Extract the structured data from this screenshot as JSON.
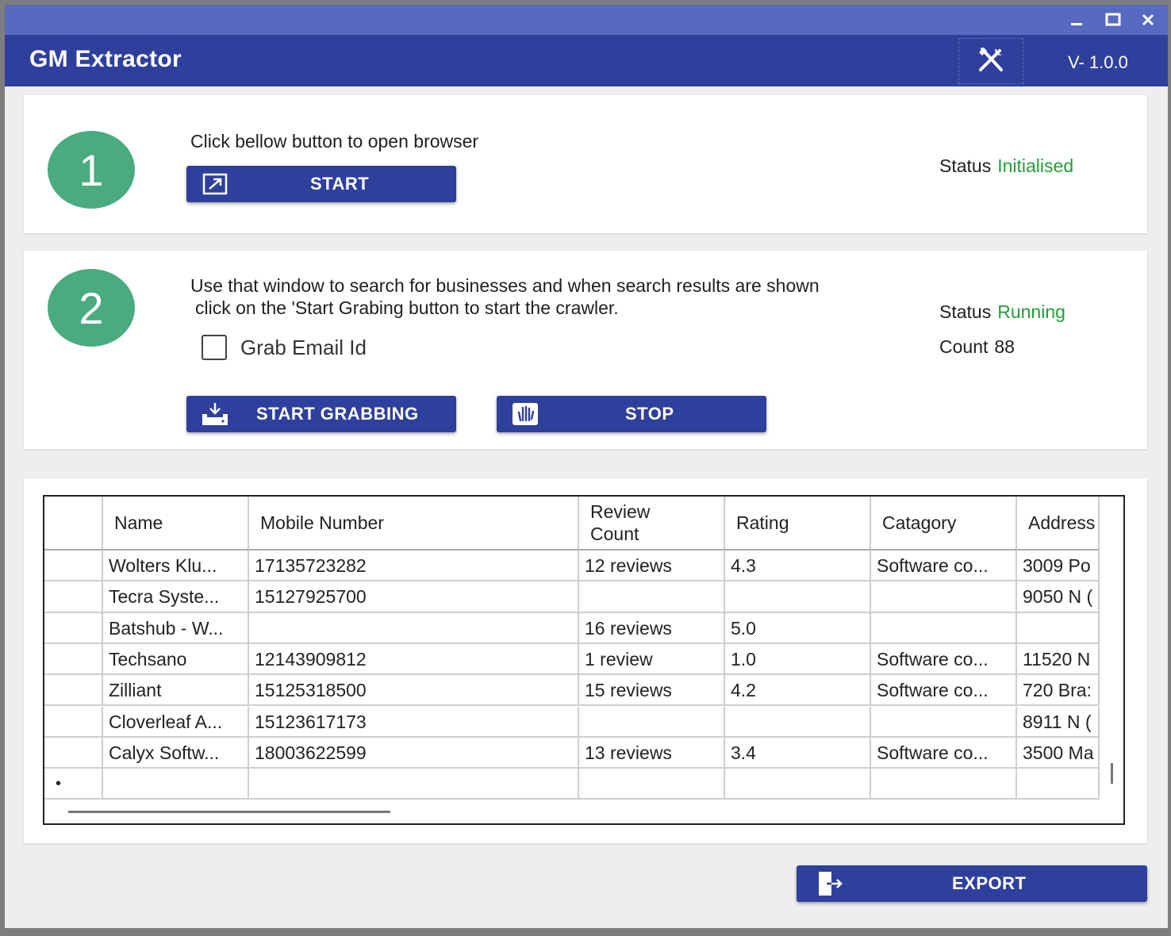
{
  "app": {
    "title": "GM Extractor",
    "version": "V- 1.0.0"
  },
  "window_controls": {
    "minimize_icon": "minimize-icon",
    "maximize_icon": "maximize-icon",
    "close_icon": "close-icon"
  },
  "settings_icon": "tools-icon",
  "step1": {
    "number": "1",
    "instruction": "Click bellow button to open browser",
    "button_label": "START",
    "button_icon": "open-external-icon",
    "status_label": "Status",
    "status_value": "Initialised"
  },
  "step2": {
    "number": "2",
    "instruction_line1": "Use that window to search for businesses and when search results are shown",
    "instruction_line2": "click on the 'Start Grabing button to start the crawler.",
    "checkbox_label": "Grab Email Id",
    "checkbox_checked": false,
    "start_grabbing_label": "START GRABBING",
    "start_grabbing_icon": "download-tray-icon",
    "stop_label": "STOP",
    "stop_icon": "hand-stop-icon",
    "status_label": "Status",
    "status_value": "Running",
    "count_label": "Count",
    "count_value": "88"
  },
  "table": {
    "columns": [
      "",
      "Name",
      "Mobile Number",
      "Review\nCount",
      "Rating",
      "Catagory",
      "Address"
    ],
    "rows": [
      [
        "",
        "Wolters Klu...",
        "17135723282",
        "12 reviews",
        "4.3",
        "Software co...",
        "3009 Po"
      ],
      [
        "",
        "Tecra Syste...",
        "15127925700",
        "",
        "",
        "",
        "9050 N ("
      ],
      [
        "",
        "Batshub - W...",
        "",
        "16 reviews",
        "5.0",
        "",
        ""
      ],
      [
        "",
        "Techsano",
        "12143909812",
        "1 review",
        "1.0",
        "Software co...",
        "11520 N"
      ],
      [
        "",
        "Zilliant",
        "15125318500",
        "15 reviews",
        "4.2",
        "Software co...",
        "720 Bra:"
      ],
      [
        "",
        "Cloverleaf A...",
        "15123617173",
        "",
        "",
        "",
        "8911 N ("
      ],
      [
        "",
        "Calyx Softw...",
        "18003622599",
        "13 reviews",
        "3.4",
        "Software co...",
        "3500 Ma"
      ],
      [
        "•",
        "",
        "",
        "",
        "",
        "",
        ""
      ]
    ]
  },
  "export": {
    "label": "EXPORT",
    "icon": "export-icon"
  },
  "colors": {
    "title_bar": "#5869c2",
    "app_bar": "#2f3f9c",
    "button": "#2f3f9c",
    "step_circle": "#4aab80",
    "status_green": "#21a035"
  }
}
